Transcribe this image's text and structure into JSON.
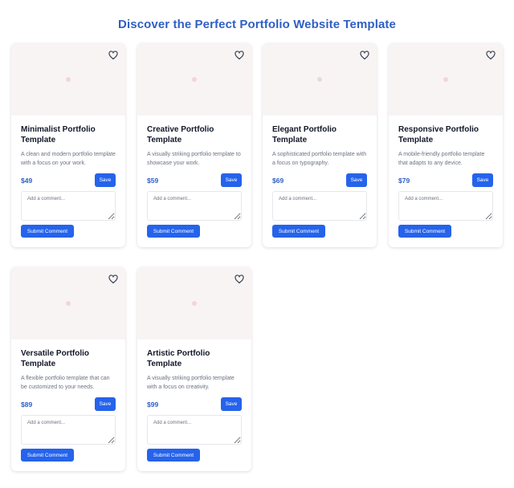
{
  "page": {
    "title": "Discover the Perfect Portfolio Website Template"
  },
  "colors": {
    "accent": "#2f5fc4",
    "button": "#2563eb",
    "image_placeholder": "#f9f4f4"
  },
  "icons": {
    "favorite": "heart-icon",
    "image": "image-placeholder-icon"
  },
  "cards": [
    {
      "title": "Minimalist Portfolio Template",
      "description": "A clean and modern portfolio template with a focus on your work.",
      "price": "$49",
      "save_label": "Save",
      "comment_placeholder": "Add a comment...",
      "submit_label": "Submit Comment"
    },
    {
      "title": "Creative Portfolio Template",
      "description": "A visually striking portfolio template to showcase your work.",
      "price": "$59",
      "save_label": "Save",
      "comment_placeholder": "Add a comment...",
      "submit_label": "Submit Comment"
    },
    {
      "title": "Elegant Portfolio Template",
      "description": "A sophisticated portfolio template with a focus on typography.",
      "price": "$69",
      "save_label": "Save",
      "comment_placeholder": "Add a comment...",
      "submit_label": "Submit Comment"
    },
    {
      "title": "Responsive Portfolio Template",
      "description": "A mobile-friendly portfolio template that adapts to any device.",
      "price": "$79",
      "save_label": "Save",
      "comment_placeholder": "Add a comment...",
      "submit_label": "Submit Comment"
    },
    {
      "title": "Versatile Portfolio Template",
      "description": "A flexible portfolio template that can be customized to your needs.",
      "price": "$89",
      "save_label": "Save",
      "comment_placeholder": "Add a comment...",
      "submit_label": "Submit Comment"
    },
    {
      "title": "Artistic Portfolio Template",
      "description": "A visually striking portfolio template with a focus on creativity.",
      "price": "$99",
      "save_label": "Save",
      "comment_placeholder": "Add a comment...",
      "submit_label": "Submit Comment"
    }
  ]
}
